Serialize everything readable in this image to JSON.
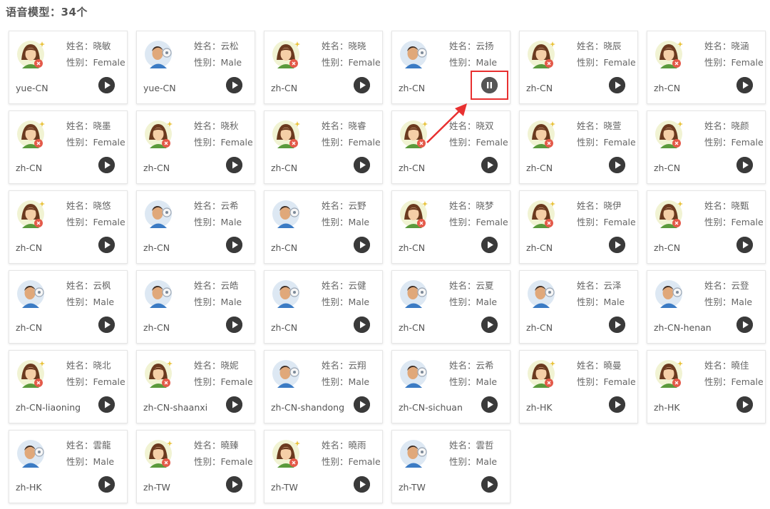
{
  "header": {
    "title": "语音模型：34个"
  },
  "labels": {
    "name_key": "姓名：",
    "gender_key": "性别："
  },
  "colors": {
    "highlight": "#e83030",
    "play_button": "#3a3a3a"
  },
  "active_voice_index": 3,
  "voices": [
    {
      "name": "晓敏",
      "gender": "Female",
      "locale": "yue-CN",
      "avatar": "female-avatar-icon",
      "state": "play"
    },
    {
      "name": "云松",
      "gender": "Male",
      "locale": "yue-CN",
      "avatar": "male-avatar-icon",
      "state": "play"
    },
    {
      "name": "晓晓",
      "gender": "Female",
      "locale": "zh-CN",
      "avatar": "female-avatar-icon",
      "state": "play"
    },
    {
      "name": "云扬",
      "gender": "Male",
      "locale": "zh-CN",
      "avatar": "male-avatar-icon",
      "state": "pause"
    },
    {
      "name": "晓辰",
      "gender": "Female",
      "locale": "zh-CN",
      "avatar": "female-avatar-icon",
      "state": "play"
    },
    {
      "name": "晓涵",
      "gender": "Female",
      "locale": "zh-CN",
      "avatar": "female-avatar-icon",
      "state": "play"
    },
    {
      "name": "晓墨",
      "gender": "Female",
      "locale": "zh-CN",
      "avatar": "female-avatar-icon",
      "state": "play"
    },
    {
      "name": "晓秋",
      "gender": "Female",
      "locale": "zh-CN",
      "avatar": "female-avatar-icon",
      "state": "play"
    },
    {
      "name": "晓睿",
      "gender": "Female",
      "locale": "zh-CN",
      "avatar": "female-avatar-icon",
      "state": "play"
    },
    {
      "name": "晓双",
      "gender": "Female",
      "locale": "zh-CN",
      "avatar": "female-avatar-icon",
      "state": "play"
    },
    {
      "name": "晓萱",
      "gender": "Female",
      "locale": "zh-CN",
      "avatar": "female-avatar-icon",
      "state": "play"
    },
    {
      "name": "晓颜",
      "gender": "Female",
      "locale": "zh-CN",
      "avatar": "female-avatar-icon",
      "state": "play"
    },
    {
      "name": "晓悠",
      "gender": "Female",
      "locale": "zh-CN",
      "avatar": "female-avatar-icon",
      "state": "play"
    },
    {
      "name": "云希",
      "gender": "Male",
      "locale": "zh-CN",
      "avatar": "male-avatar-icon",
      "state": "play"
    },
    {
      "name": "云野",
      "gender": "Male",
      "locale": "zh-CN",
      "avatar": "male-avatar-icon",
      "state": "play"
    },
    {
      "name": "晓梦",
      "gender": "Female",
      "locale": "zh-CN",
      "avatar": "female-avatar-icon",
      "state": "play"
    },
    {
      "name": "晓伊",
      "gender": "Female",
      "locale": "zh-CN",
      "avatar": "female-avatar-icon",
      "state": "play"
    },
    {
      "name": "晓甄",
      "gender": "Female",
      "locale": "zh-CN",
      "avatar": "female-avatar-icon",
      "state": "play"
    },
    {
      "name": "云枫",
      "gender": "Male",
      "locale": "zh-CN",
      "avatar": "male-avatar-icon",
      "state": "play"
    },
    {
      "name": "云皓",
      "gender": "Male",
      "locale": "zh-CN",
      "avatar": "male-avatar-icon",
      "state": "play"
    },
    {
      "name": "云健",
      "gender": "Male",
      "locale": "zh-CN",
      "avatar": "male-avatar-icon",
      "state": "play"
    },
    {
      "name": "云夏",
      "gender": "Male",
      "locale": "zh-CN",
      "avatar": "male-avatar-icon",
      "state": "play"
    },
    {
      "name": "云泽",
      "gender": "Male",
      "locale": "zh-CN",
      "avatar": "male-avatar-icon",
      "state": "play"
    },
    {
      "name": "云登",
      "gender": "Male",
      "locale": "zh-CN-henan",
      "avatar": "male-avatar-icon",
      "state": "play"
    },
    {
      "name": "晓北",
      "gender": "Female",
      "locale": "zh-CN-liaoning",
      "avatar": "female-avatar-icon",
      "state": "play"
    },
    {
      "name": "晓妮",
      "gender": "Female",
      "locale": "zh-CN-shaanxi",
      "avatar": "female-avatar-icon",
      "state": "play"
    },
    {
      "name": "云翔",
      "gender": "Male",
      "locale": "zh-CN-shandong",
      "avatar": "male-avatar-icon",
      "state": "play"
    },
    {
      "name": "云希",
      "gender": "Male",
      "locale": "zh-CN-sichuan",
      "avatar": "male-avatar-icon",
      "state": "play"
    },
    {
      "name": "曉曼",
      "gender": "Female",
      "locale": "zh-HK",
      "avatar": "female-avatar-icon",
      "state": "play"
    },
    {
      "name": "曉佳",
      "gender": "Female",
      "locale": "zh-HK",
      "avatar": "female-avatar-icon",
      "state": "play"
    },
    {
      "name": "雲龍",
      "gender": "Male",
      "locale": "zh-HK",
      "avatar": "male-avatar-icon",
      "state": "play"
    },
    {
      "name": "曉臻",
      "gender": "Female",
      "locale": "zh-TW",
      "avatar": "female-avatar-icon",
      "state": "play"
    },
    {
      "name": "曉雨",
      "gender": "Female",
      "locale": "zh-TW",
      "avatar": "female-avatar-icon",
      "state": "play"
    },
    {
      "name": "雲哲",
      "gender": "Male",
      "locale": "zh-TW",
      "avatar": "male-avatar-icon",
      "state": "play"
    }
  ]
}
